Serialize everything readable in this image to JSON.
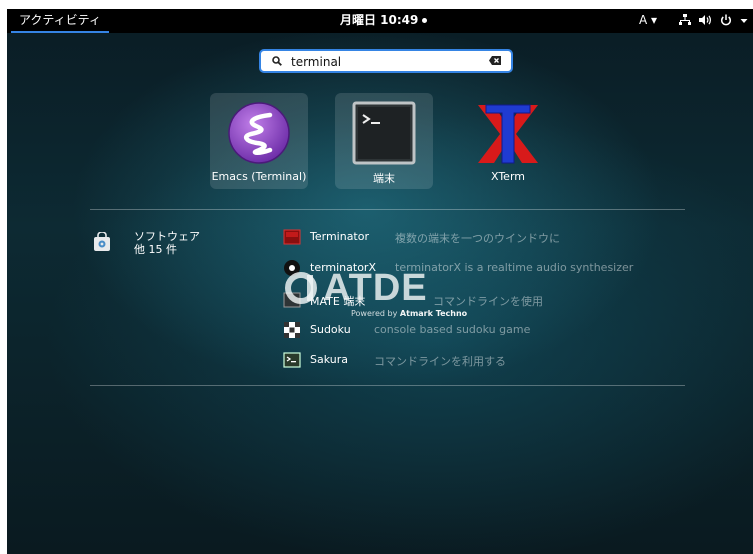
{
  "topbar": {
    "activities": "アクティビティ",
    "clock": "月曜日 10:49",
    "input_method": "A ▾"
  },
  "search": {
    "value": "terminal"
  },
  "apps": [
    {
      "label": "Emacs (Terminal)",
      "icon": "emacs-icon",
      "selected": true
    },
    {
      "label": "端末",
      "icon": "terminal-icon",
      "selected": true
    },
    {
      "label": "XTerm",
      "icon": "xterm-icon",
      "selected": false
    }
  ],
  "provider": {
    "name": "ソフトウェア",
    "count": "他 15 件",
    "icon": "software-bag-icon"
  },
  "results": [
    {
      "name": "Terminator",
      "desc": "複数の端末を一つのウインドウに",
      "icon": "terminator-icon"
    },
    {
      "name": "terminatorX",
      "desc": "terminatorX is a realtime audio synthesizer",
      "icon": "terminatorx-icon"
    },
    {
      "name": "MATE 端末",
      "desc": "コマンドラインを使用",
      "icon": "mate-terminal-icon"
    },
    {
      "name": "Sudoku",
      "desc": "console based sudoku game",
      "icon": "sudoku-icon"
    },
    {
      "name": "Sakura",
      "desc": "コマンドラインを利用する",
      "icon": "sakura-icon"
    }
  ],
  "watermark": {
    "logo": "ATDE",
    "powered": "Powered by",
    "brand": "Atmark Techno"
  },
  "colors": {
    "accent": "#3584e4",
    "topbar": "#000000"
  }
}
